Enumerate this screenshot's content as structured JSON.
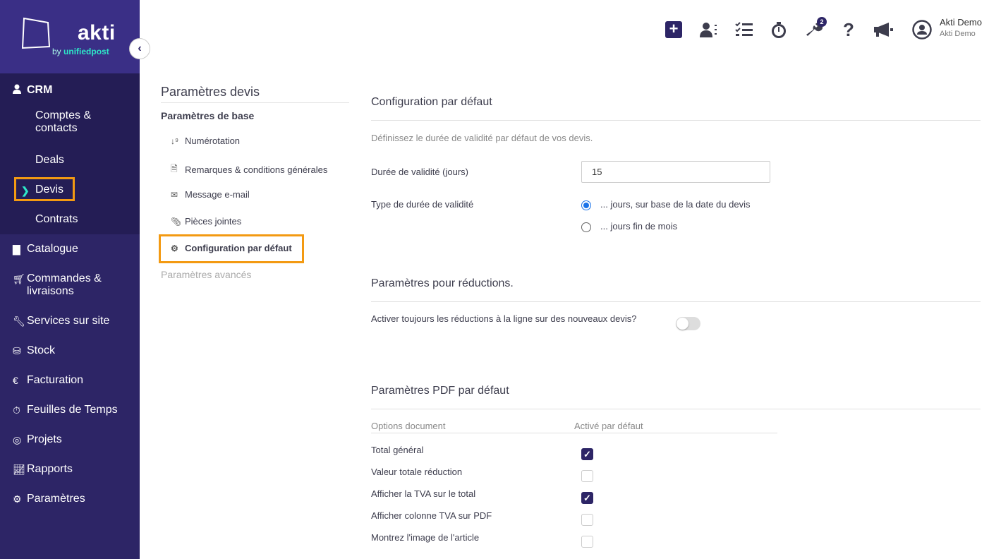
{
  "brand": {
    "name": "akti",
    "sub_prefix": "by",
    "sub_name": "unifiedpost",
    "accent": "#2ee6c8",
    "sidebar_bg": "#2d2566",
    "highlight": "#f39a12"
  },
  "sidebar": {
    "crm": "CRM",
    "crm_items": [
      "Comptes &",
      "contacts",
      "Deals",
      "Devis",
      "Contrats"
    ],
    "items": {
      "catalogue": "Catalogue",
      "commandes_1": "Commandes &",
      "commandes_2": "livraisons",
      "services": "Services sur site",
      "stock": "Stock",
      "facturation": "Facturation",
      "feuilles": "Feuilles de Temps",
      "projets": "Projets",
      "rapports": "Rapports",
      "parametres": "Paramètres"
    }
  },
  "topbar": {
    "badge_count": "2",
    "user_name": "Akti Demo",
    "user_company": "Akti Demo"
  },
  "settings_menu": {
    "title": "Paramètres devis",
    "base": "Paramètres de base",
    "items": {
      "numerotation": "Numérotation",
      "remarques": "Remarques & conditions générales",
      "message": "Message e-mail",
      "pieces": "Pièces jointes",
      "configuration": "Configuration par défaut"
    },
    "advanced": "Paramètres avancés"
  },
  "config": {
    "title": "Configuration par défaut",
    "description": "Définissez le durée de validité par défaut de vos devis.",
    "validity_label": "Durée de validité (jours)",
    "validity_value": "15",
    "type_label": "Type de durée de validité",
    "option_1": "... jours, sur base de la date du devis",
    "option_2": "... jours fin de mois",
    "selected_option": 1
  },
  "reductions": {
    "title": "Paramètres pour réductions.",
    "toggle_label": "Activer toujours les réductions à la ligne sur des nouveaux devis?",
    "toggle_on": false
  },
  "pdf": {
    "title": "Paramètres PDF par défaut",
    "col_options": "Options document",
    "col_active": "Activé par défaut",
    "rows": {
      "total": "Total général",
      "reduction": "Valeur totale réduction",
      "tva_total": "Afficher la TVA sur le total",
      "tva_col": "Afficher colonne TVA sur PDF",
      "image": "Montrez l'image de l'article"
    },
    "checked": {
      "total": true,
      "reduction": false,
      "tva_total": true,
      "tva_col": false,
      "image": false
    }
  }
}
